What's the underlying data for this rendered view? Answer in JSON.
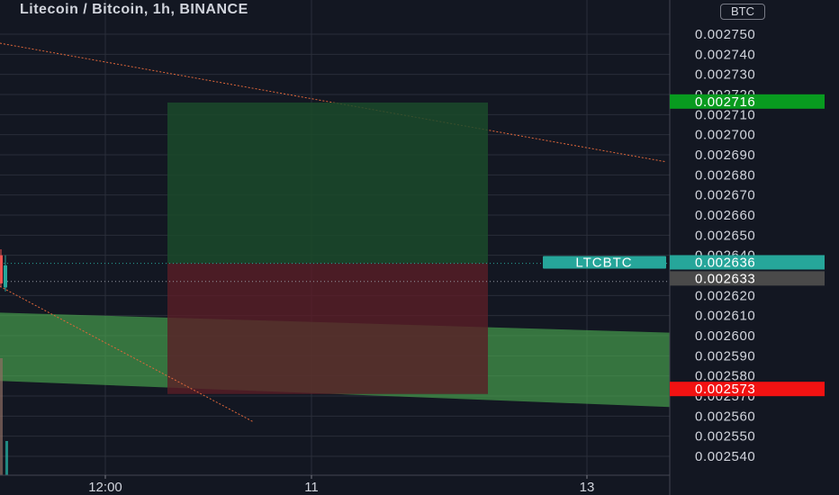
{
  "header": {
    "title": "Litecoin / Bitcoin, 1h, BINANCE",
    "currency_badge": "BTC"
  },
  "colors": {
    "background": "#131722",
    "grid": "#2a2e39",
    "text": "#d1d4dc",
    "up": "#26a69a",
    "down": "#ef5350",
    "target_zone": "#1b4a2a",
    "stop_zone": "#5a1e27",
    "channel": "#4caf50",
    "trendline": "#e0673a",
    "target_label": "#089b1f",
    "stop_label": "#f21212",
    "ticker_label": "#26a69a",
    "last_label": "#4a4a4a"
  },
  "chart_data": {
    "type": "candlestick",
    "symbol": "LTCBTC",
    "x_ticks": [
      "12:00",
      "11",
      "13"
    ],
    "y_ticks": [
      "0.002750",
      "0.002740",
      "0.002730",
      "0.002720",
      "0.002710",
      "0.002700",
      "0.002690",
      "0.002680",
      "0.002670",
      "0.002660",
      "0.002650",
      "0.002640",
      "0.002620",
      "0.002610",
      "0.002600",
      "0.002590",
      "0.002580",
      "0.002570",
      "0.002560",
      "0.002550",
      "0.002540"
    ],
    "y_range": [
      0.002536,
      0.002762
    ],
    "price_labels": [
      {
        "name": "target",
        "value": 0.002716,
        "text": "0.002716"
      },
      {
        "name": "current",
        "value": 0.002636,
        "text": "0.002636",
        "ticker": "LTCBTC"
      },
      {
        "name": "last",
        "value": 0.002633,
        "text": "0.002633"
      },
      {
        "name": "stop",
        "value": 0.002573,
        "text": "0.002573"
      }
    ],
    "position_tool": {
      "entry": 0.002636,
      "target": 0.002716,
      "stop": 0.002571
    },
    "volume_bars": [
      {
        "color": "down"
      },
      {
        "color": "up"
      }
    ]
  }
}
